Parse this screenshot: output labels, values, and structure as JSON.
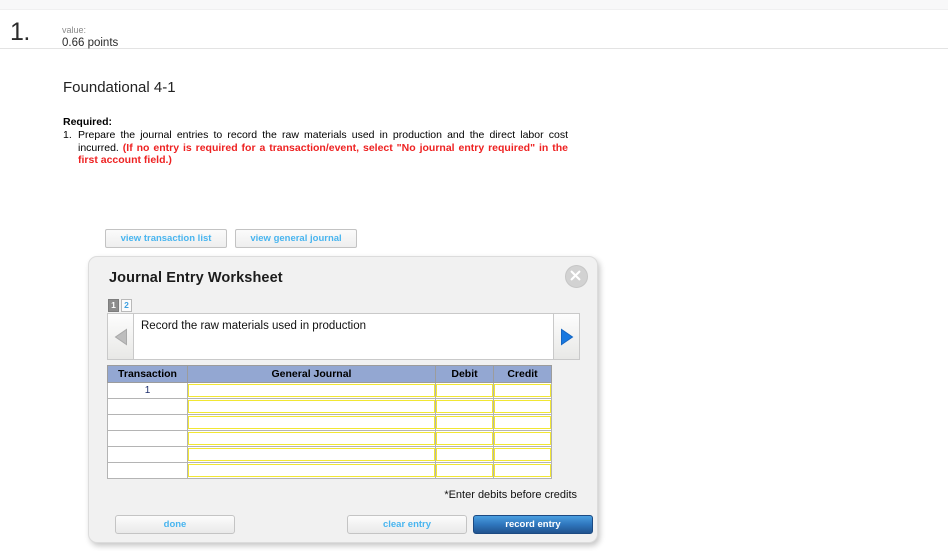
{
  "question": {
    "number": "1.",
    "value_label": "value:",
    "points": "0.66 points"
  },
  "page_title": "Foundational 4-1",
  "required": {
    "heading": "Required:",
    "marker": "1.",
    "text_black": "Prepare the journal entries to record the raw materials used in production and the direct labor cost incurred.",
    "text_red": "(If no entry is required for a transaction/event, select \"No journal entry required\" in the first account field.)"
  },
  "view_buttons": [
    {
      "label": "view transaction list"
    },
    {
      "label": "view general journal"
    }
  ],
  "worksheet": {
    "title": "Journal Entry Worksheet",
    "close_icon": "close-icon",
    "tabs": [
      {
        "label": "1",
        "active": true
      },
      {
        "label": "2",
        "active": false
      }
    ],
    "nav": {
      "prev_icon": "left-triangle-icon",
      "next_icon": "right-triangle-icon",
      "prev_enabled": false,
      "next_enabled": true,
      "description": "Record the raw materials used in production"
    },
    "table": {
      "columns": [
        "Transaction",
        "General Journal",
        "Debit",
        "Credit"
      ],
      "rows": [
        {
          "transaction": "1",
          "general_journal": "",
          "debit": "",
          "credit": ""
        },
        {
          "transaction": "",
          "general_journal": "",
          "debit": "",
          "credit": ""
        },
        {
          "transaction": "",
          "general_journal": "",
          "debit": "",
          "credit": ""
        },
        {
          "transaction": "",
          "general_journal": "",
          "debit": "",
          "credit": ""
        },
        {
          "transaction": "",
          "general_journal": "",
          "debit": "",
          "credit": ""
        },
        {
          "transaction": "",
          "general_journal": "",
          "debit": "",
          "credit": ""
        }
      ]
    },
    "note": "*Enter debits before credits",
    "buttons": {
      "done": "done",
      "clear": "clear entry",
      "record": "record entry"
    }
  },
  "colors": {
    "link_blue": "#49b5ef",
    "header_blue": "#93a7d2",
    "input_yellow": "#f2e733",
    "alert_red": "#ee2222",
    "record_blue": "#2f76bd"
  }
}
